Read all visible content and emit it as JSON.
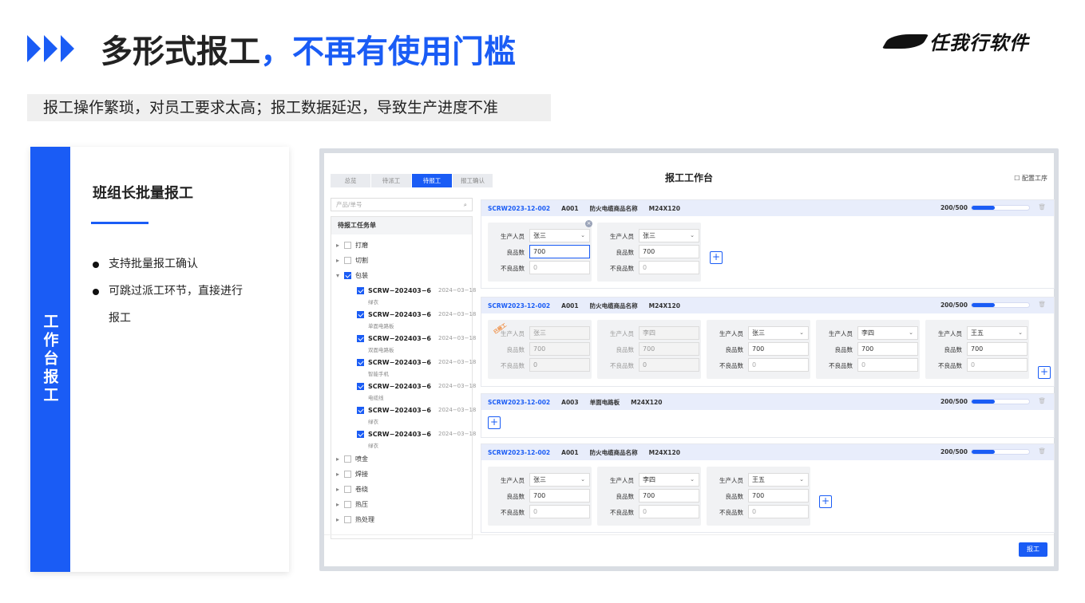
{
  "header": {
    "title_part1": "多形式报工",
    "title_part2": "，不再有使用门槛",
    "logo_text": "任我行软件"
  },
  "subtitle": "报工操作繁琐，对员工要求太高；报工数据延迟，导致生产进度不准",
  "left_card": {
    "vertical_label": "工作台报工",
    "title": "班组长批量报工",
    "bullets": [
      "支持批量报工确认",
      "可跳过派工环节，直接进行",
      "报工"
    ]
  },
  "app": {
    "title": "报工工作台",
    "config_label": "配置工序",
    "tabs": [
      "总览",
      "待派工",
      "待报工",
      "报工确认"
    ],
    "search_placeholder": "产品/单号",
    "task_list_title": "待报工任务单",
    "tree": {
      "top": [
        "打磨",
        "切割",
        "包装"
      ],
      "bottom": [
        "喷金",
        "焊接",
        "卷绕",
        "热压",
        "热处理"
      ]
    },
    "sub_items": [
      {
        "code": "SCRW−202403−6",
        "date": "2024−03−18",
        "name": "绿衣"
      },
      {
        "code": "SCRW−202403−6",
        "date": "2024−03−18",
        "name": "单面电路板"
      },
      {
        "code": "SCRW−202403−6",
        "date": "2024−03−18",
        "name": "双面电路板"
      },
      {
        "code": "SCRW−202403−6",
        "date": "2024−03−18",
        "name": "智能手机"
      },
      {
        "code": "SCRW−202403−6",
        "date": "2024−03−18",
        "name": "电缆线"
      },
      {
        "code": "SCRW−202403−6",
        "date": "2024−03−18",
        "name": "绿衣"
      },
      {
        "code": "SCRW−202403−6",
        "date": "2024−03−18",
        "name": "绿衣"
      }
    ],
    "labels": {
      "person": "生产人员",
      "good": "良品数",
      "bad": "不良品数"
    },
    "orders": [
      {
        "code": "SCRW2023-12-002",
        "op": "A001",
        "product": "防火电缆商品名称",
        "spec": "M24X120",
        "progress": "200/500",
        "fraction": 0.4,
        "cards": [
          {
            "person": "张三",
            "good": "700",
            "bad": "0"
          },
          {
            "person": "张三",
            "good": "700",
            "bad": "0"
          }
        ]
      },
      {
        "code": "SCRW2023-12-002",
        "op": "A001",
        "product": "防火电缆商品名称",
        "spec": "M24X120",
        "progress": "200/500",
        "fraction": 0.4,
        "stamp": "已报工",
        "cards": [
          {
            "person": "张三",
            "good": "700",
            "bad": "0"
          },
          {
            "person": "李四",
            "good": "700",
            "bad": "0"
          },
          {
            "person": "张三",
            "good": "700",
            "bad": "0"
          },
          {
            "person": "李四",
            "good": "700",
            "bad": "0"
          },
          {
            "person": "王五",
            "good": "700",
            "bad": "0"
          }
        ]
      },
      {
        "code": "SCRW2023-12-002",
        "op": "A003",
        "product": "单面电路板",
        "spec": "M24X120",
        "progress": "200/500",
        "fraction": 0.4,
        "cards": []
      },
      {
        "code": "SCRW2023-12-002",
        "op": "A001",
        "product": "防火电缆商品名称",
        "spec": "M24X120",
        "progress": "200/500",
        "fraction": 0.4,
        "cards": [
          {
            "person": "张三",
            "good": "700",
            "bad": "0"
          },
          {
            "person": "李四",
            "good": "700",
            "bad": "0"
          },
          {
            "person": "王五",
            "good": "700",
            "bad": "0"
          }
        ]
      }
    ],
    "submit_label": "报工"
  }
}
